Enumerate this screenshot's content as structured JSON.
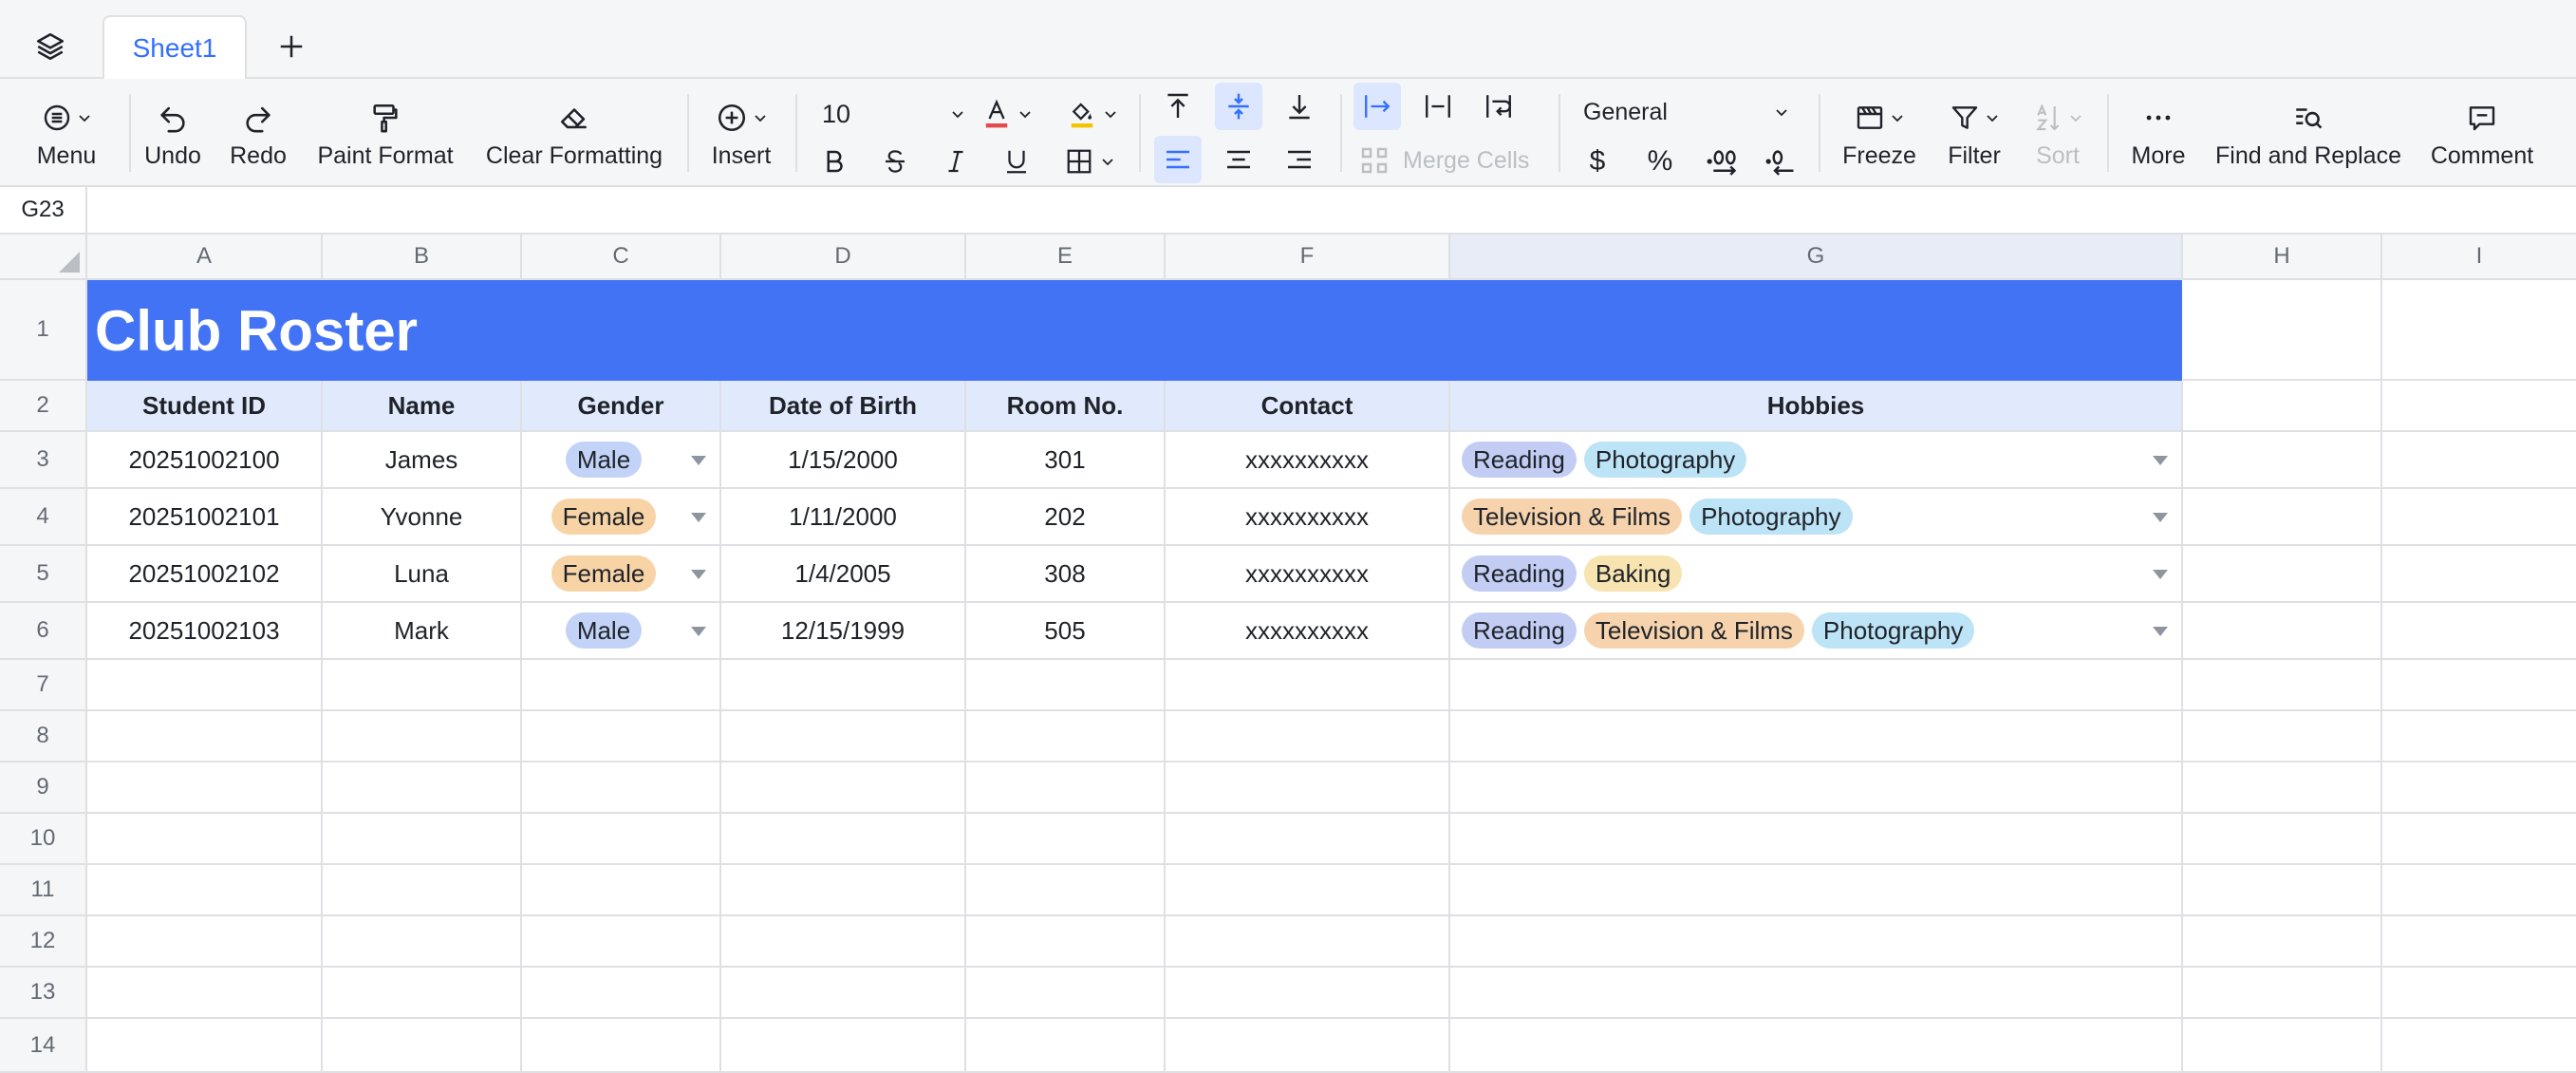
{
  "tabs": {
    "sheet_name": "Sheet1"
  },
  "toolbar": {
    "menu": "Menu",
    "undo": "Undo",
    "redo": "Redo",
    "paint_format": "Paint Format",
    "clear_formatting": "Clear Formatting",
    "insert": "Insert",
    "font_size": "10",
    "merge_cells": "Merge Cells",
    "number_format": "General",
    "currency_symbol": "$",
    "percent_symbol": "%",
    "freeze": "Freeze",
    "filter": "Filter",
    "sort": "Sort",
    "more": "More",
    "find_replace": "Find and Replace",
    "comment": "Comment"
  },
  "formula_bar": {
    "cell_ref": "G23",
    "value": ""
  },
  "columns": [
    "A",
    "B",
    "C",
    "D",
    "E",
    "F",
    "G",
    "H",
    "I"
  ],
  "rows": [
    "1",
    "2",
    "3",
    "4",
    "5",
    "6",
    "7",
    "8",
    "9",
    "10",
    "11",
    "12",
    "13",
    "14"
  ],
  "sheet": {
    "title": "Club Roster",
    "headers": [
      "Student ID",
      "Name",
      "Gender",
      "Date of Birth",
      "Room No.",
      "Contact",
      "Hobbies"
    ],
    "records": [
      {
        "id": "20251002100",
        "name": "James",
        "gender": "Male",
        "dob": "1/15/2000",
        "room": "301",
        "contact": "xxxxxxxxxx",
        "hobbies": [
          "Reading",
          "Photography"
        ]
      },
      {
        "id": "20251002101",
        "name": "Yvonne",
        "gender": "Female",
        "dob": "1/11/2000",
        "room": "202",
        "contact": "xxxxxxxxxx",
        "hobbies": [
          "Television & Films",
          "Photography"
        ]
      },
      {
        "id": "20251002102",
        "name": "Luna",
        "gender": "Female",
        "dob": "1/4/2005",
        "room": "308",
        "contact": "xxxxxxxxxx",
        "hobbies": [
          "Reading",
          "Baking"
        ]
      },
      {
        "id": "20251002103",
        "name": "Mark",
        "gender": "Male",
        "dob": "12/15/1999",
        "room": "505",
        "contact": "xxxxxxxxxx",
        "hobbies": [
          "Reading",
          "Television & Films",
          "Photography"
        ]
      }
    ]
  },
  "colors": {
    "accent": "#3370ff",
    "title_fill": "#4373f5",
    "header_fill": "#e1eafd",
    "chip_male": "#c3d3f7",
    "chip_female": "#f8d3a6",
    "chip_reading": "#c3cdf4",
    "chip_photography": "#bde3f6",
    "chip_tv_films": "#f6d3ad",
    "chip_baking": "#f8e4b0"
  }
}
